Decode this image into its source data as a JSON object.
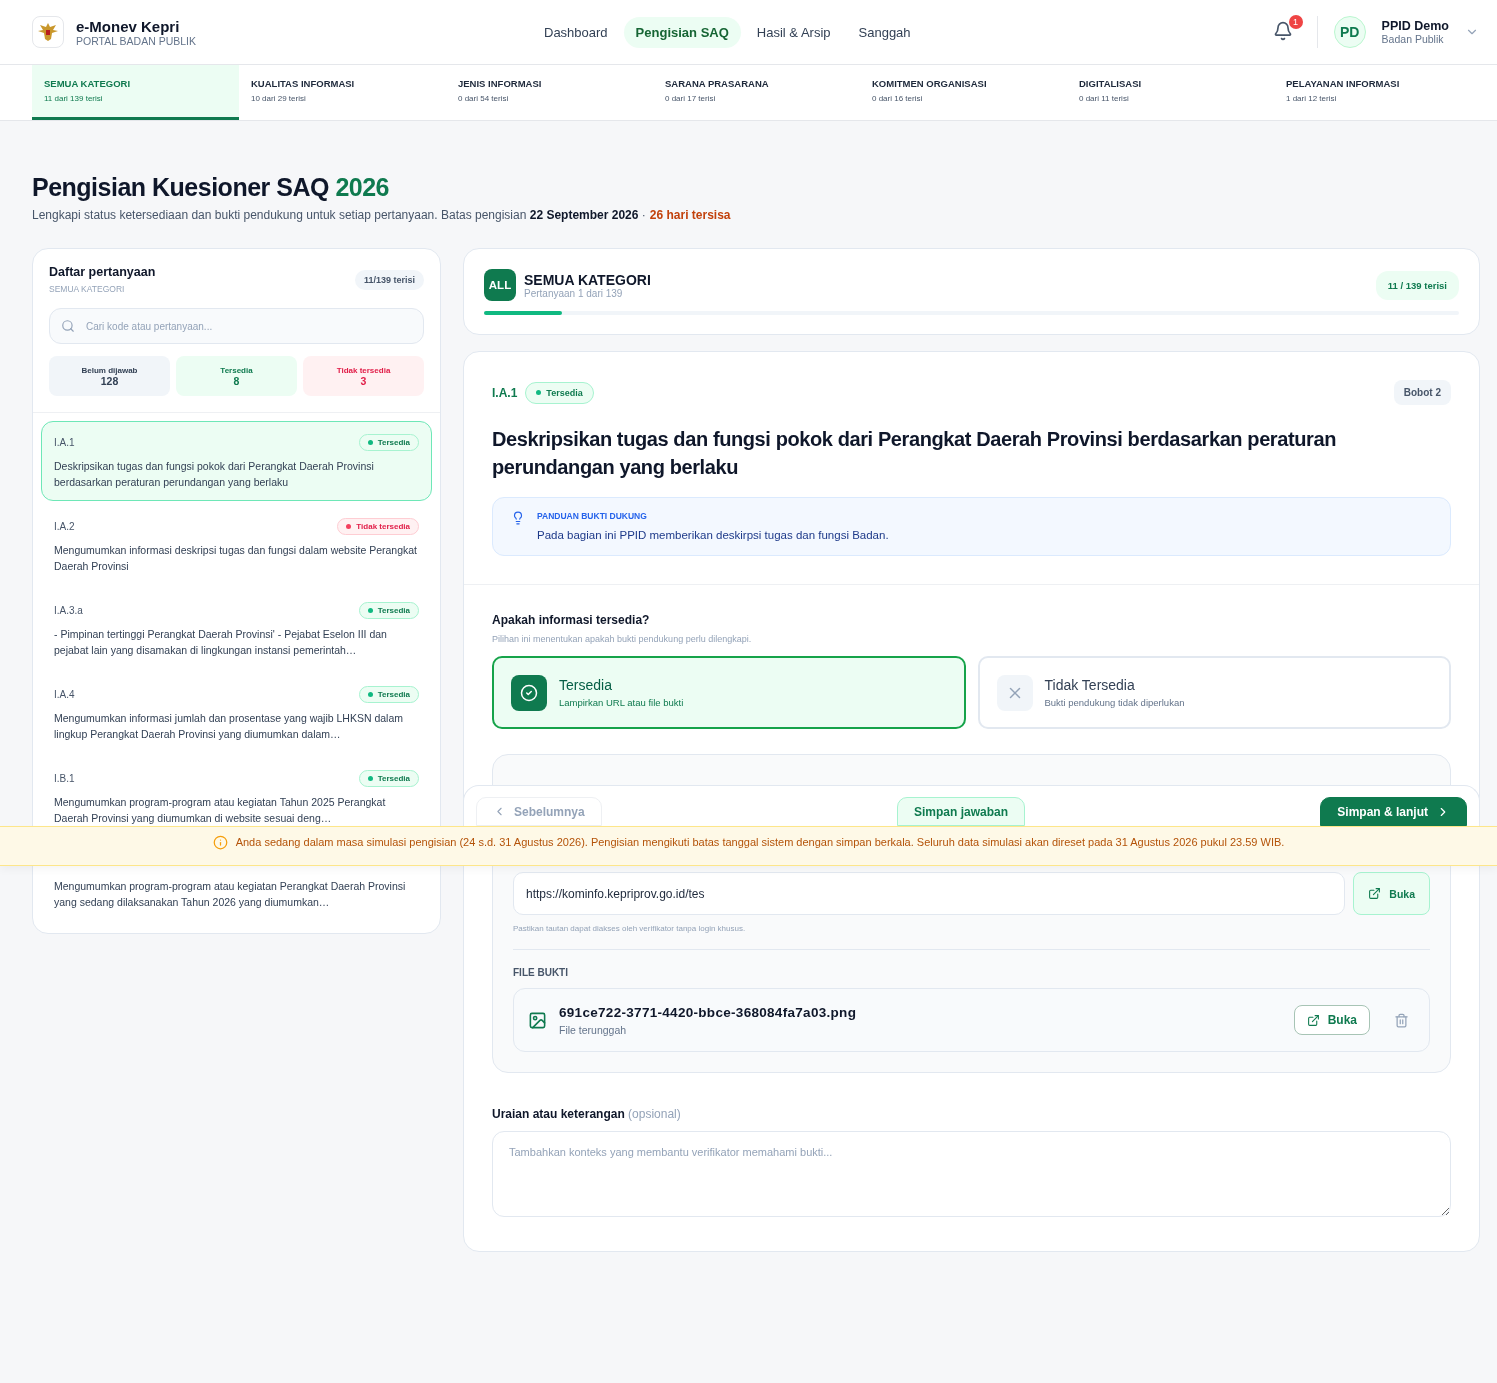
{
  "header": {
    "brand": "e-Monev Kepri",
    "brand_subtitle": "PORTAL BADAN PUBLIK",
    "nav": [
      {
        "label": "Dashboard",
        "selected": false
      },
      {
        "label": "Pengisian SAQ",
        "selected": true
      },
      {
        "label": "Hasil & Arsip",
        "selected": false
      },
      {
        "label": "Sanggah",
        "selected": false
      }
    ],
    "notification_count": "1",
    "user": {
      "initials": "PD",
      "name": "PPID Demo",
      "role": "Badan Publik"
    }
  },
  "category_tabs": [
    {
      "label": "SEMUA KATEGORI",
      "count": "11 dari 139 terisi",
      "selected": true
    },
    {
      "label": "KUALITAS INFORMASI",
      "count": "10 dari 29 terisi",
      "selected": false
    },
    {
      "label": "JENIS INFORMASI",
      "count": "0 dari 54 terisi",
      "selected": false
    },
    {
      "label": "SARANA PRASARANA",
      "count": "0 dari 17 terisi",
      "selected": false
    },
    {
      "label": "KOMITMEN ORGANISASI",
      "count": "0 dari 16 terisi",
      "selected": false
    },
    {
      "label": "DIGITALISASI",
      "count": "0 dari 11 terisi",
      "selected": false
    },
    {
      "label": "PELAYANAN INFORMASI",
      "count": "1 dari 12 terisi",
      "selected": false
    }
  ],
  "page": {
    "title": "Pengisian Kuesioner SAQ",
    "year": "2026",
    "subtitle": "Lengkapi status ketersediaan dan bukti pendukung untuk setiap pertanyaan. Batas pengisian **22 September 2026** ·",
    "remaining": "26 hari tersisa"
  },
  "sidebar": {
    "title": "Daftar pertanyaan",
    "subtitle": "SEMUA KATEGORI",
    "count": "11/139 terisi",
    "search_placeholder": "Cari kode atau pertanyaan...",
    "stats": [
      {
        "kind": "unanswered",
        "label": "Belum dijawab",
        "value": "128"
      },
      {
        "kind": "available",
        "label": "Tersedia",
        "value": "8"
      },
      {
        "kind": "unavailable",
        "label": "Tidak tersedia",
        "value": "3"
      }
    ],
    "items": [
      {
        "code": "I.A.1",
        "kind": "available",
        "status_label": "Tersedia",
        "text": "Deskripsikan tugas dan fungsi pokok dari Perangkat Daerah Provinsi berdasarkan peraturan perundangan yang berlaku",
        "selected": true
      },
      {
        "code": "I.A.2",
        "kind": "unavailable",
        "status_label": "Tidak tersedia",
        "text": "Mengumumkan informasi deskripsi tugas dan fungsi dalam website Perangkat Daerah Provinsi",
        "selected": false
      },
      {
        "code": "I.A.3.a",
        "kind": "available",
        "status_label": "Tersedia",
        "text": "- Pimpinan tertinggi Perangkat Daerah Provinsi' - Pejabat Eselon III dan pejabat lain yang disamakan di lingkungan instansi pemerintah…",
        "selected": false
      },
      {
        "code": "I.A.4",
        "kind": "available",
        "status_label": "Tersedia",
        "text": "Mengumumkan informasi jumlah dan prosentase yang wajib LHKSN dalam lingkup Perangkat Daerah Provinsi yang diumumkan dalam…",
        "selected": false
      },
      {
        "code": "I.B.1",
        "kind": "available",
        "status_label": "Tersedia",
        "text": "Mengumumkan program-program atau kegiatan Tahun 2025 Perangkat Daerah Provinsi yang diumumkan di website sesuai deng…",
        "selected": false
      },
      {
        "text": "Mengumumkan program-program atau kegiatan Perangkat Daerah Provinsi yang sedang dilaksanakan Tahun 2026 yang diumumkan…",
        "selected": false
      }
    ]
  },
  "progress_card": {
    "badge": "ALL",
    "category": "SEMUA KATEGORI",
    "position": "Pertanyaan 1 dari 139",
    "count": "11 / 139 terisi",
    "level": 0.08
  },
  "question": {
    "code": "I.A.1",
    "kind": "available",
    "status_label": "Tersedia",
    "weight": "Bobot 2",
    "title": "Deskripsikan tugas dan fungsi pokok dari Perangkat Daerah Provinsi berdasarkan peraturan perundangan yang berlaku",
    "guide": {
      "label": "PANDUAN BUKTI DUKUNG",
      "text": "Pada bagian ini PPID memberikan deskirpsi tugas dan fungsi Badan."
    }
  },
  "availability": {
    "question": "Apakah informasi tersedia?",
    "hint": "Pilihan ini menentukan apakah bukti pendukung perlu dilengkapi.",
    "options": [
      {
        "kind": "yes",
        "title": "Tersedia",
        "subtitle": "Lampirkan URL atau file bukti",
        "selected": true
      },
      {
        "kind": "no",
        "title": "Tidak Tersedia",
        "subtitle": "Bukti pendukung tidak diperlukan",
        "selected": false
      }
    ]
  },
  "evidence": {
    "url": "https://kominfo.kepriprov.go.id/tes",
    "open_label": "Buka",
    "url_hint": "Pastikan tautan dapat diakses oleh verifikator tanpa login khusus.",
    "file_label": "FILE BUKTI",
    "file": {
      "name": "691ce722-3771-4420-bbce-368084fa7a03.png",
      "status": "File terunggah",
      "open_label": "Buka"
    }
  },
  "notes": {
    "label": "Uraian atau keterangan",
    "optional": "(opsional)",
    "placeholder": "Tambahkan konteks yang membantu verifikator memahami bukti..."
  },
  "actions": {
    "previous": "Sebelumnya",
    "previous_disabled": true,
    "save": "Simpan jawaban",
    "next": "Simpan & lanjut"
  },
  "banner": {
    "text": "Anda sedang dalam masa simulasi pengisian (24 s.d. 31 Agustus 2026). Pengisian mengikuti batas tanggal sistem dengan simpan berkala. Seluruh data simulasi akan direset pada 31 Agustus 2026 pukul 23.59 WIB."
  }
}
